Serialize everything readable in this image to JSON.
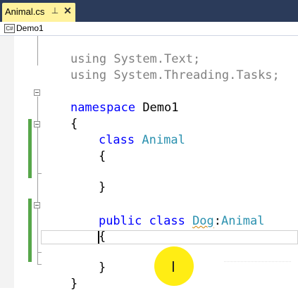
{
  "tab": {
    "label": "Animal.cs",
    "pin": "⊥",
    "close": "✕"
  },
  "navbar": {
    "icon": "C#",
    "label": "Demo1"
  },
  "code": {
    "line1": {
      "kw": "using",
      "rest": " System.Text;"
    },
    "line2": {
      "kw": "using",
      "rest": " System.Threading.Tasks;"
    },
    "ns": {
      "kw": "namespace",
      "rest": " Demo1"
    },
    "open1": "{",
    "class1": {
      "kw": "class",
      "name": "Animal"
    },
    "open2": "{",
    "close2": "}",
    "class2": {
      "kw1": "public",
      "kw2": "class",
      "name": "Dog",
      "sep": ":",
      "base": "Animal"
    },
    "open3": "{",
    "close3": "}",
    "close1": "}"
  },
  "colors": {
    "keyword": "#0000ff",
    "type": "#2b91af",
    "changebar": "#57a64a",
    "tabstrip": "#2b3b5a",
    "tab": "#fff29d",
    "highlight": "#ffeb00"
  },
  "icons": {
    "nav": "csharp-file-icon",
    "pin": "pin-icon",
    "close": "close-icon",
    "cursor": "i-beam-cursor-icon"
  }
}
